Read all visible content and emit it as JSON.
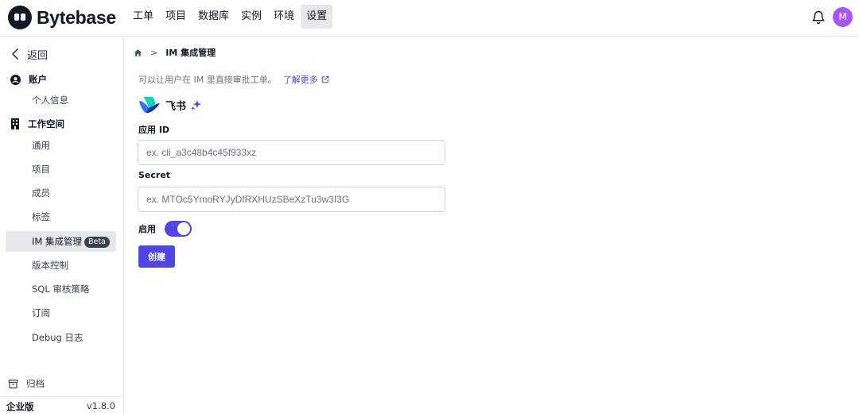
{
  "app": {
    "name": "Bytebase"
  },
  "header": {
    "nav": [
      "工单",
      "项目",
      "数据库",
      "实例",
      "环境",
      "设置"
    ],
    "active_nav": "设置",
    "avatar_initial": "M",
    "avatar_color": "#a855f7"
  },
  "sidebar": {
    "back_label": "返回",
    "account_section": "账户",
    "account_items": [
      "个人信息"
    ],
    "workspace_section": "工作空间",
    "workspace_items": [
      "通用",
      "项目",
      "成员",
      "标签",
      "IM 集成管理",
      "版本控制",
      "SQL 审核策略",
      "订阅",
      "Debug 日志"
    ],
    "active_item": "IM 集成管理",
    "active_badge": "Beta",
    "archive_label": "归档",
    "edition": "企业版",
    "version": "v1.8.0"
  },
  "main": {
    "breadcrumb_sep": ">",
    "breadcrumb_current": "IM 集成管理",
    "description": "可以让用户在 IM 里直接审批工单。",
    "learn_more": "了解更多",
    "provider_name": "飞书",
    "app_id_label": "应用 ID",
    "app_id_placeholder": "ex. cli_a3c48b4c45f933xz",
    "app_id_value": "",
    "secret_label": "Secret",
    "secret_placeholder": "ex. MTOc5YmoRYJyDfRXHUzSBeXzTu3w3I3G",
    "secret_value": "",
    "enable_label": "启用",
    "enabled": true,
    "create_button": "创建"
  },
  "colors": {
    "accent": "#4f46e5",
    "nav_active_bg": "#e5e7eb",
    "badge_bg": "#374151"
  }
}
